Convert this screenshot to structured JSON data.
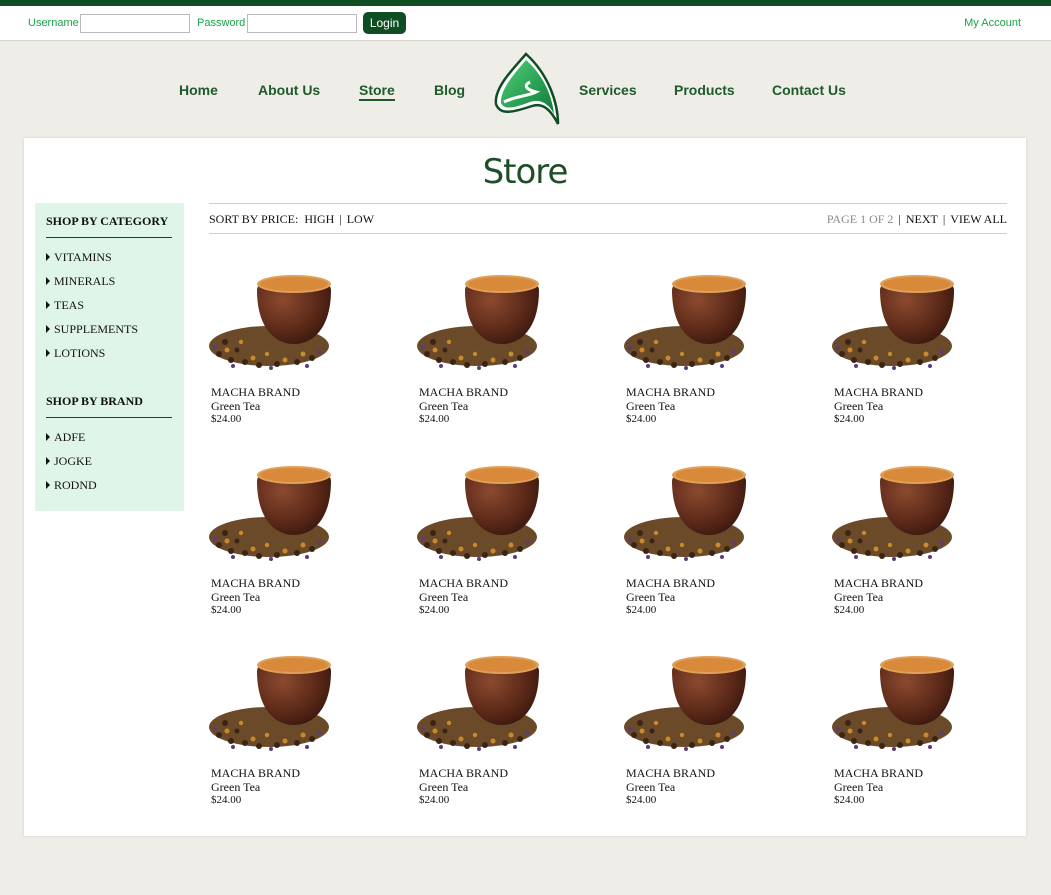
{
  "login": {
    "username_label": "Username",
    "password_label": "Password",
    "login_button": "Login",
    "my_account": "My Account"
  },
  "nav": {
    "home": "Home",
    "about": "About Us",
    "store": "Store",
    "blog": "Blog",
    "services": "Services",
    "products": "Products",
    "contact": "Contact Us"
  },
  "page": {
    "title": "Store"
  },
  "sidebar": {
    "category_heading": "SHOP BY CATEGORY",
    "categories": [
      "VITAMINS",
      "MINERALS",
      "TEAS",
      "SUPPLEMENTS",
      "LOTIONS"
    ],
    "brand_heading": "SHOP BY BRAND",
    "brands": [
      "ADFE",
      "JOGKE",
      "RODND"
    ]
  },
  "sortbar": {
    "sort_label": "SORT BY PRICE:",
    "high": "HIGH",
    "low": "LOW",
    "page_info": "PAGE 1 OF 2",
    "next": "NEXT",
    "view_all": "VIEW ALL"
  },
  "products": [
    {
      "brand": "MACHA BRAND",
      "name": "Green Tea",
      "price": "$24.00"
    },
    {
      "brand": "MACHA BRAND",
      "name": "Green Tea",
      "price": "$24.00"
    },
    {
      "brand": "MACHA BRAND",
      "name": "Green Tea",
      "price": "$24.00"
    },
    {
      "brand": "MACHA BRAND",
      "name": "Green Tea",
      "price": "$24.00"
    },
    {
      "brand": "MACHA BRAND",
      "name": "Green Tea",
      "price": "$24.00"
    },
    {
      "brand": "MACHA BRAND",
      "name": "Green Tea",
      "price": "$24.00"
    },
    {
      "brand": "MACHA BRAND",
      "name": "Green Tea",
      "price": "$24.00"
    },
    {
      "brand": "MACHA BRAND",
      "name": "Green Tea",
      "price": "$24.00"
    },
    {
      "brand": "MACHA BRAND",
      "name": "Green Tea",
      "price": "$24.00"
    },
    {
      "brand": "MACHA BRAND",
      "name": "Green Tea",
      "price": "$24.00"
    },
    {
      "brand": "MACHA BRAND",
      "name": "Green Tea",
      "price": "$24.00"
    },
    {
      "brand": "MACHA BRAND",
      "name": "Green Tea",
      "price": "$24.00"
    }
  ],
  "colors": {
    "brand_dark_green": "#0e4e22",
    "accent_green": "#1aa34a",
    "sidebar_bg": "#dff5e8",
    "page_bg": "#efede8"
  },
  "icons": {
    "logo": "leaf-logo-icon",
    "bullet": "triangle-right-icon",
    "product_image": "tea-cup-image"
  }
}
